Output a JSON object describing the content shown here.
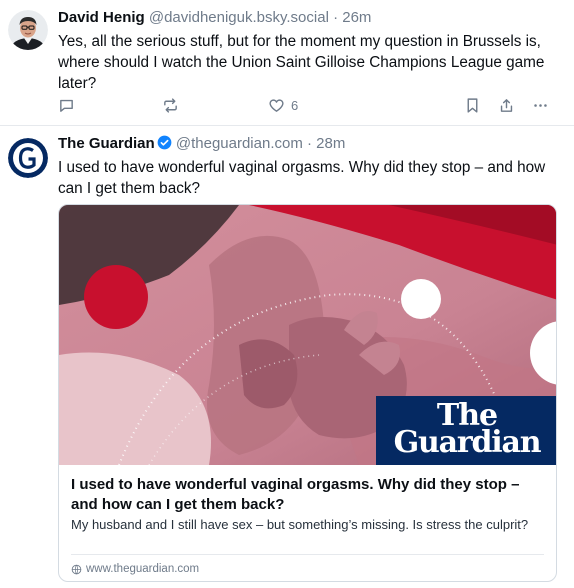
{
  "posts": [
    {
      "author_name": "David Henig",
      "author_handle": "@davidheniguk.bsky.social",
      "separator": "·",
      "time": "26m",
      "text": "Yes, all the serious stuff, but for the moment my question in Brussels is, where should I watch the Union Saint Gilloise Champions League game later?",
      "like_count": "6"
    },
    {
      "author_name": "The Guardian",
      "author_handle": "@theguardian.com",
      "separator": "·",
      "time": "28m",
      "text": "I used to have wonderful vaginal orgasms. Why did they stop – and how can I get them back?",
      "card": {
        "title": "I used to have wonderful vaginal orgasms. Why did they stop – and how can I get them back?",
        "description": "My husband and I still have sex – but something’s missing. Is stress the culprit?",
        "domain": "www.theguardian.com",
        "logo_line1": "The",
        "logo_line2": "Guardian"
      }
    }
  ],
  "colors": {
    "text": "#0b0f14",
    "muted": "#6f7b8a",
    "verified": "#1083fe",
    "guardian_blue": "#052962",
    "image_pink": "#d99aa6",
    "image_red": "#c8102e"
  },
  "icons": [
    "reply-icon",
    "repost-icon",
    "like-icon",
    "bookmark-icon",
    "share-icon",
    "more-icon",
    "verified-icon",
    "globe-icon"
  ]
}
